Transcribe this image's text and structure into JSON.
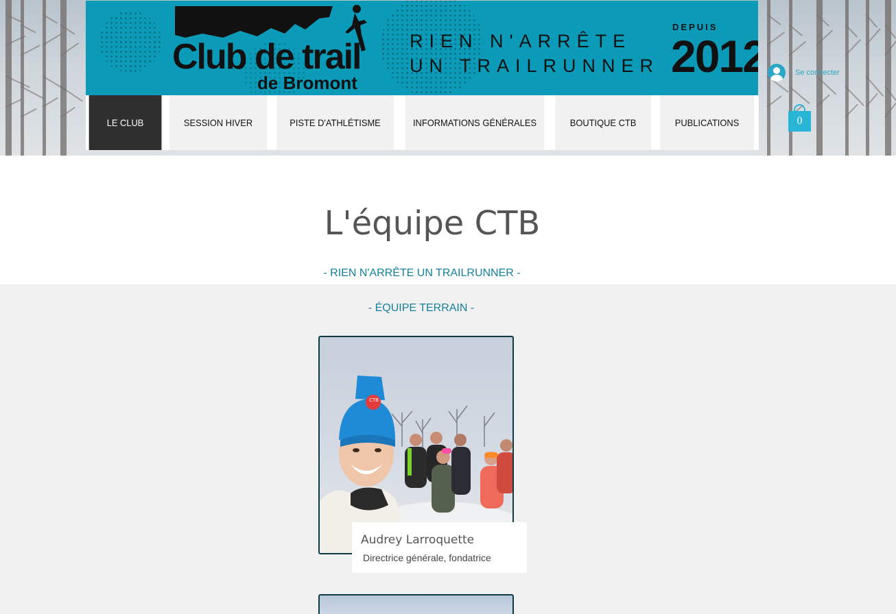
{
  "banner": {
    "logo_main": "Club de trail",
    "logo_sub": "de Bromont",
    "slogan_line1": "RIEN N'ARRÊTE",
    "slogan_line2": "UN TRAILRUNNER",
    "since_label": "DEPUIS",
    "since_year": "2012"
  },
  "nav": {
    "items": [
      {
        "label": "LE CLUB",
        "active": true
      },
      {
        "label": "SESSION HIVER",
        "active": false
      },
      {
        "label": "PISTE D'ATHLÉTISME",
        "active": false
      },
      {
        "label": "INFORMATIONS GÉNÉRALES",
        "active": false
      },
      {
        "label": "BOUTIQUE CTB",
        "active": false
      },
      {
        "label": "PUBLICATIONS",
        "active": false
      }
    ]
  },
  "header": {
    "login_label": "Se connecter",
    "cart_count": "0"
  },
  "main": {
    "title": "L'équipe CTB",
    "tagline": "- RIEN N'ARRÊTE UN TRAILRUNNER -",
    "section_label": "- ÉQUIPE TERRAIN -",
    "members": [
      {
        "name": "Audrey Larroquette",
        "role": "Directrice générale, fondatrice",
        "cap_logo": "CTB"
      }
    ]
  },
  "colors": {
    "banner_bg": "#0b9bb9",
    "accent_text": "#13809a",
    "nav_active_bg": "#2f2f2f",
    "cart": "#29b5d6"
  }
}
